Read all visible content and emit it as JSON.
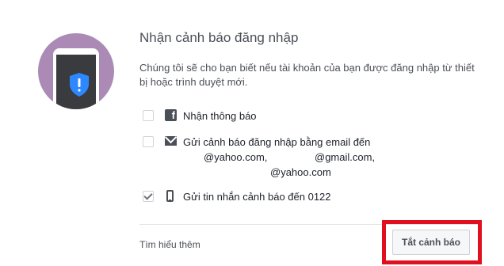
{
  "header": {
    "title": "Nhận cảnh báo đăng nhập"
  },
  "description": "Chúng tôi sẽ cho bạn biết nếu tài khoản của bạn được đăng nhập từ thiết bị hoặc trình duyệt mới.",
  "options": [
    {
      "label": "Nhận thông báo",
      "icon": "facebook-icon",
      "checked": false
    },
    {
      "label": "Gửi cảnh báo đăng nhập bằng email đến",
      "icon": "mail-icon",
      "checked": false,
      "emails": [
        "@yahoo.com,",
        "@gmail.com,",
        "@yahoo.com"
      ]
    },
    {
      "label": "Gửi tin nhắn cảnh báo đến 0122",
      "icon": "mobile-phone-icon",
      "checked": true
    }
  ],
  "footer": {
    "learn_more": "Tìm hiểu thêm",
    "disable_button": "Tắt cảnh báo"
  },
  "colors": {
    "illustration_bg": "#ab8ab6",
    "shield": "#2d88ff",
    "highlight_border": "#e0101f"
  }
}
